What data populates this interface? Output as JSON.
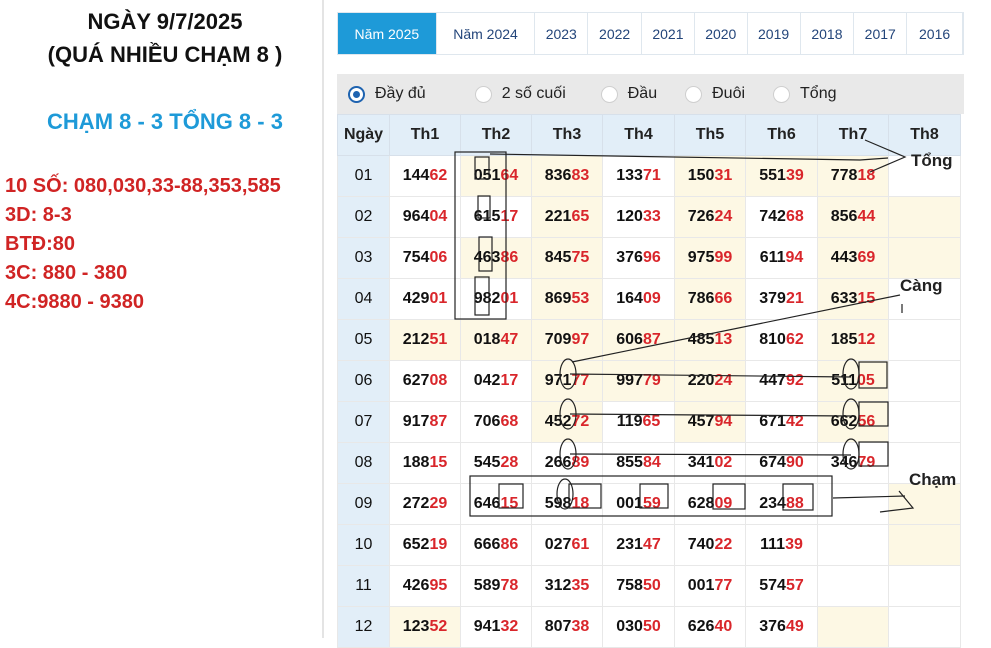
{
  "notes": {
    "title1": "NGÀY 9/7/2025",
    "title2": "(QUÁ NHIỀU CHẠM 8 )",
    "cham_tong": "CHẠM 8 - 3  TỔNG 8 - 3",
    "lines": [
      "10 SỐ: 080,030,33-88,353,585",
      "3D: 8-3",
      "BTĐ:80",
      "3C: 880 - 380",
      "4C:9880 - 9380"
    ]
  },
  "tabs": [
    "Năm 2025",
    "Năm 2024",
    "2023",
    "2022",
    "2021",
    "2020",
    "2019",
    "2018",
    "2017",
    "2016"
  ],
  "active_tab": 0,
  "filters": [
    {
      "label": "Đầy đủ",
      "checked": true
    },
    {
      "label": "2 số cuối",
      "checked": false
    },
    {
      "label": "Đầu",
      "checked": false
    },
    {
      "label": "Đuôi",
      "checked": false
    },
    {
      "label": "Tổng",
      "checked": false
    }
  ],
  "table": {
    "headers": [
      "Ngày",
      "Th1",
      "Th2",
      "Th3",
      "Th4",
      "Th5",
      "Th6",
      "Th7",
      "Th8"
    ],
    "rows": [
      {
        "day": "01",
        "cells": [
          [
            "144",
            "62"
          ],
          [
            "051",
            "64"
          ],
          [
            "836",
            "83"
          ],
          [
            "133",
            "71"
          ],
          [
            "150",
            "31"
          ],
          [
            "551",
            "39"
          ],
          [
            "778",
            "18"
          ],
          [
            "",
            ""
          ]
        ]
      },
      {
        "day": "02",
        "cells": [
          [
            "964",
            "04"
          ],
          [
            "615",
            "17"
          ],
          [
            "221",
            "65"
          ],
          [
            "120",
            "33"
          ],
          [
            "726",
            "24"
          ],
          [
            "742",
            "68"
          ],
          [
            "856",
            "44"
          ],
          [
            "",
            ""
          ]
        ]
      },
      {
        "day": "03",
        "cells": [
          [
            "754",
            "06"
          ],
          [
            "463",
            "86"
          ],
          [
            "845",
            "75"
          ],
          [
            "376",
            "96"
          ],
          [
            "975",
            "99"
          ],
          [
            "611",
            "94"
          ],
          [
            "443",
            "69"
          ],
          [
            "",
            ""
          ]
        ]
      },
      {
        "day": "04",
        "cells": [
          [
            "429",
            "01"
          ],
          [
            "982",
            "01"
          ],
          [
            "869",
            "53"
          ],
          [
            "164",
            "09"
          ],
          [
            "786",
            "66"
          ],
          [
            "379",
            "21"
          ],
          [
            "633",
            "15"
          ],
          [
            "",
            ""
          ]
        ]
      },
      {
        "day": "05",
        "cells": [
          [
            "212",
            "51"
          ],
          [
            "018",
            "47"
          ],
          [
            "709",
            "97"
          ],
          [
            "606",
            "87"
          ],
          [
            "485",
            "13"
          ],
          [
            "810",
            "62"
          ],
          [
            "185",
            "12"
          ],
          [
            "",
            ""
          ]
        ]
      },
      {
        "day": "06",
        "cells": [
          [
            "627",
            "08"
          ],
          [
            "042",
            "17"
          ],
          [
            "971",
            "77"
          ],
          [
            "997",
            "79"
          ],
          [
            "220",
            "24"
          ],
          [
            "447",
            "92"
          ],
          [
            "511",
            "05"
          ],
          [
            "",
            ""
          ]
        ]
      },
      {
        "day": "07",
        "cells": [
          [
            "917",
            "87"
          ],
          [
            "706",
            "68"
          ],
          [
            "452",
            "72"
          ],
          [
            "119",
            "65"
          ],
          [
            "457",
            "94"
          ],
          [
            "671",
            "42"
          ],
          [
            "662",
            "56"
          ],
          [
            "",
            ""
          ]
        ]
      },
      {
        "day": "08",
        "cells": [
          [
            "188",
            "15"
          ],
          [
            "545",
            "28"
          ],
          [
            "266",
            "89"
          ],
          [
            "855",
            "84"
          ],
          [
            "341",
            "02"
          ],
          [
            "674",
            "90"
          ],
          [
            "346",
            "79"
          ],
          [
            "",
            ""
          ]
        ]
      },
      {
        "day": "09",
        "cells": [
          [
            "272",
            "29"
          ],
          [
            "646",
            "15"
          ],
          [
            "598",
            "18"
          ],
          [
            "001",
            "59"
          ],
          [
            "628",
            "09"
          ],
          [
            "234",
            "88"
          ],
          [
            "",
            ""
          ],
          [
            "",
            ""
          ]
        ]
      },
      {
        "day": "10",
        "cells": [
          [
            "652",
            "19"
          ],
          [
            "666",
            "86"
          ],
          [
            "027",
            "61"
          ],
          [
            "231",
            "47"
          ],
          [
            "740",
            "22"
          ],
          [
            "111",
            "39"
          ],
          [
            "",
            ""
          ],
          [
            "",
            ""
          ]
        ]
      },
      {
        "day": "11",
        "cells": [
          [
            "426",
            "95"
          ],
          [
            "589",
            "78"
          ],
          [
            "312",
            "35"
          ],
          [
            "758",
            "50"
          ],
          [
            "001",
            "77"
          ],
          [
            "574",
            "57"
          ],
          [
            "",
            ""
          ],
          [
            "",
            ""
          ]
        ]
      },
      {
        "day": "12",
        "cells": [
          [
            "123",
            "52"
          ],
          [
            "941",
            "32"
          ],
          [
            "807",
            "38"
          ],
          [
            "030",
            "50"
          ],
          [
            "626",
            "40"
          ],
          [
            "376",
            "49"
          ],
          [
            "",
            ""
          ],
          [
            "",
            ""
          ]
        ]
      }
    ]
  },
  "annotations": {
    "tong": "Tổng",
    "cang": "Càng",
    "cham": "Chạm"
  },
  "colors": {
    "accent": "#1e9ad8",
    "tail_red": "#d9262b",
    "header_bg": "#e2eef8",
    "highlight_bg": "#fdf8e4",
    "notes_red": "#d02424"
  }
}
